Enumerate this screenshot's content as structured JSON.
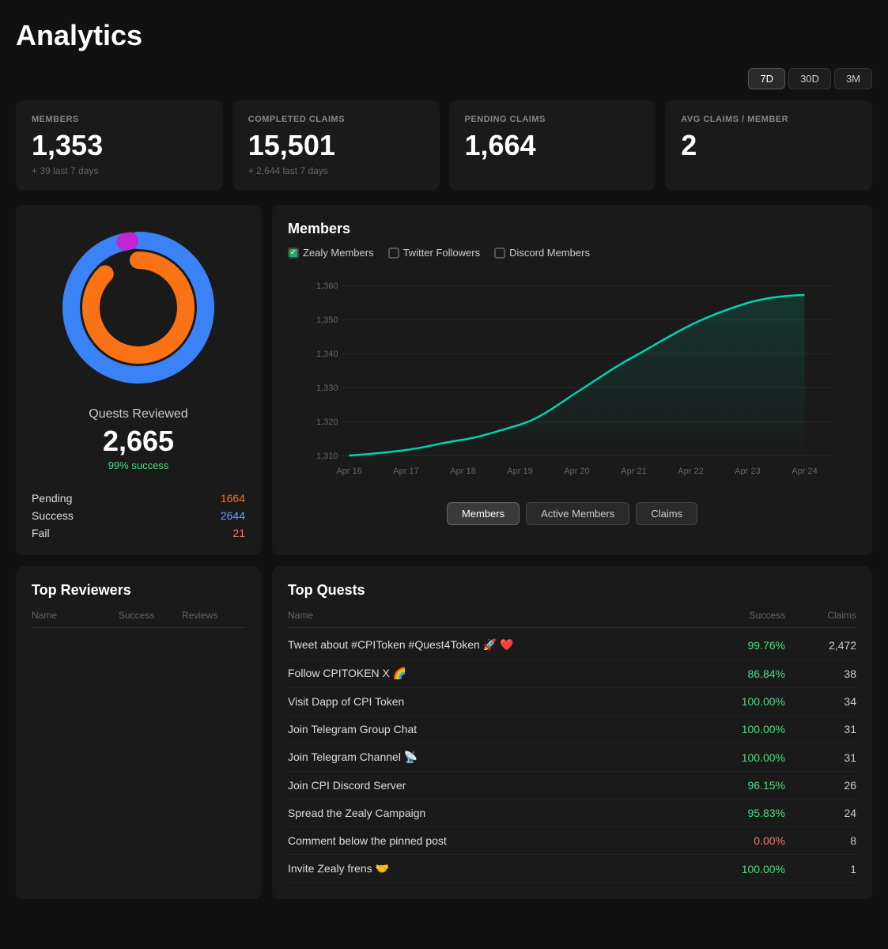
{
  "page": {
    "title": "Analytics"
  },
  "time_filters": {
    "options": [
      "7D",
      "30D",
      "3M"
    ],
    "active": "7D"
  },
  "stats": [
    {
      "label": "MEMBERS",
      "value": "1,353",
      "sub": "+ 39 last 7 days"
    },
    {
      "label": "COMPLETED CLAIMS",
      "value": "15,501",
      "sub": "+ 2,644 last 7 days"
    },
    {
      "label": "PENDING CLAIMS",
      "value": "1,664",
      "sub": ""
    },
    {
      "label": "AVG CLAIMS / MEMBER",
      "value": "2",
      "sub": ""
    }
  ],
  "donut": {
    "quests_reviewed_label": "Quests Reviewed",
    "quests_reviewed_value": "2,665",
    "success_pct": "99% success",
    "pending": {
      "label": "Pending",
      "value": "1664"
    },
    "success": {
      "label": "Success",
      "value": "2644"
    },
    "fail": {
      "label": "Fail",
      "value": "21"
    }
  },
  "members_chart": {
    "title": "Members",
    "legend": [
      {
        "label": "Zealy Members",
        "checked": true
      },
      {
        "label": "Twitter Followers",
        "checked": false
      },
      {
        "label": "Discord Members",
        "checked": false
      }
    ],
    "y_labels": [
      "1,360",
      "1,350",
      "1,340",
      "1,330",
      "1,320",
      "1,310"
    ],
    "x_labels": [
      "Apr 16",
      "Apr 17",
      "Apr 18",
      "Apr 19",
      "Apr 20",
      "Apr 21",
      "Apr 22",
      "Apr 23",
      "Apr 24"
    ],
    "tabs": [
      "Members",
      "Active Members",
      "Claims"
    ],
    "active_tab": "Members"
  },
  "top_reviewers": {
    "title": "Top Reviewers",
    "headers": [
      "Name",
      "Success",
      "Reviews"
    ],
    "rows": []
  },
  "top_quests": {
    "title": "Top Quests",
    "headers": [
      "Name",
      "Success",
      "Claims"
    ],
    "rows": [
      {
        "name": "Tweet about #CPIToken #Quest4Token 🚀 ❤️",
        "success": "99.76%",
        "claims": "2,472",
        "success_color": "green"
      },
      {
        "name": "Follow CPITOKEN X 🌈",
        "success": "86.84%",
        "claims": "38",
        "success_color": "green"
      },
      {
        "name": "Visit Dapp of CPI Token",
        "success": "100.00%",
        "claims": "34",
        "success_color": "green"
      },
      {
        "name": "Join Telegram Group Chat",
        "success": "100.00%",
        "claims": "31",
        "success_color": "green"
      },
      {
        "name": "Join Telegram Channel 📡",
        "success": "100.00%",
        "claims": "31",
        "success_color": "green"
      },
      {
        "name": "Join CPI Discord Server",
        "success": "96.15%",
        "claims": "26",
        "success_color": "green"
      },
      {
        "name": "Spread the Zealy Campaign",
        "success": "95.83%",
        "claims": "24",
        "success_color": "green"
      },
      {
        "name": "Comment below the pinned post",
        "success": "0.00%",
        "claims": "8",
        "success_color": "red"
      },
      {
        "name": "Invite Zealy frens 🤝",
        "success": "100.00%",
        "claims": "1",
        "success_color": "green"
      }
    ]
  }
}
